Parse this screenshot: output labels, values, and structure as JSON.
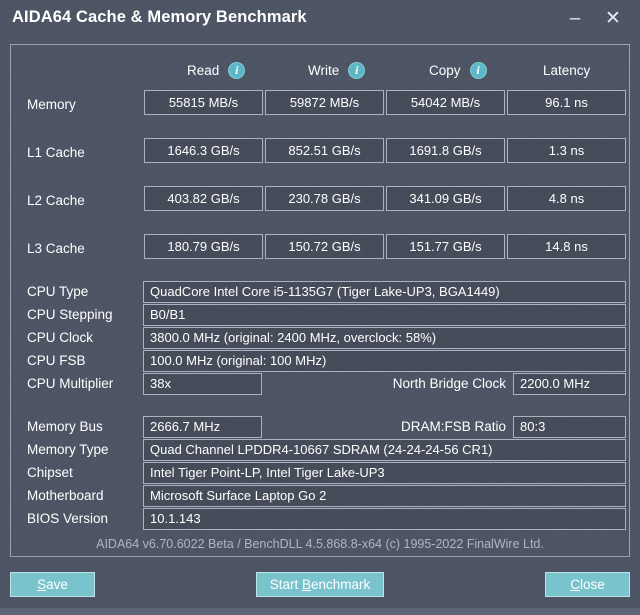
{
  "window": {
    "title": "AIDA64 Cache & Memory Benchmark",
    "minimize_glyph": "–",
    "close_glyph": "✕"
  },
  "benchmark": {
    "columns": [
      {
        "label": "Read",
        "info_icon": "info-icon",
        "has_info": true,
        "icon_glyph": "i"
      },
      {
        "label": "Write",
        "info_icon": "info-icon",
        "has_info": true,
        "icon_glyph": "i"
      },
      {
        "label": "Copy",
        "info_icon": "info-icon",
        "has_info": true,
        "icon_glyph": "i"
      },
      {
        "label": "Latency",
        "info_icon": "",
        "has_info": false,
        "icon_glyph": ""
      }
    ],
    "rows": [
      {
        "label": "Memory",
        "read": "55815 MB/s",
        "write": "59872 MB/s",
        "copy": "54042 MB/s",
        "latency": "96.1 ns"
      },
      {
        "label": "L1 Cache",
        "read": "1646.3 GB/s",
        "write": "852.51 GB/s",
        "copy": "1691.8 GB/s",
        "latency": "1.3 ns"
      },
      {
        "label": "L2 Cache",
        "read": "403.82 GB/s",
        "write": "230.78 GB/s",
        "copy": "341.09 GB/s",
        "latency": "4.8 ns"
      },
      {
        "label": "L3 Cache",
        "read": "180.79 GB/s",
        "write": "150.72 GB/s",
        "copy": "151.77 GB/s",
        "latency": "14.8 ns"
      }
    ]
  },
  "cpu_info": {
    "cpu_type_label": "CPU Type",
    "cpu_type_value": "QuadCore Intel Core i5-1135G7  (Tiger Lake-UP3, BGA1449)",
    "cpu_stepping_label": "CPU Stepping",
    "cpu_stepping_value": "B0/B1",
    "cpu_clock_label": "CPU Clock",
    "cpu_clock_value": "3800.0 MHz  (original: 2400 MHz, overclock: 58%)",
    "cpu_fsb_label": "CPU FSB",
    "cpu_fsb_value": "100.0 MHz  (original: 100 MHz)",
    "cpu_multiplier_label": "CPU Multiplier",
    "cpu_multiplier_value": "38x",
    "north_bridge_clock_label": "North Bridge Clock",
    "north_bridge_clock_value": "2200.0 MHz"
  },
  "memory_info": {
    "memory_bus_label": "Memory Bus",
    "memory_bus_value": "2666.7 MHz",
    "dram_fsb_ratio_label": "DRAM:FSB Ratio",
    "dram_fsb_ratio_value": "80:3",
    "memory_type_label": "Memory Type",
    "memory_type_value": "Quad Channel LPDDR4-10667 SDRAM  (24-24-24-56 CR1)",
    "chipset_label": "Chipset",
    "chipset_value": "Intel Tiger Point-LP, Intel Tiger Lake-UP3",
    "motherboard_label": "Motherboard",
    "motherboard_value": "Microsoft Surface Laptop Go 2",
    "bios_version_label": "BIOS Version",
    "bios_version_value": "10.1.143"
  },
  "footer": {
    "version_text": "AIDA64 v6.70.6022 Beta / BenchDLL 4.5.868.8-x64  (c) 1995-2022 FinalWire Ltd.",
    "save_prefix": "",
    "save_accel": "S",
    "save_suffix": "ave",
    "start_prefix": "Start ",
    "start_accel": "B",
    "start_suffix": "enchmark",
    "close_prefix": "",
    "close_accel": "C",
    "close_suffix": "lose"
  },
  "colors": {
    "window_bg": "#4d5464",
    "accent_teal": "#79c3cd",
    "info_icon": "#5bb8c4",
    "border": "#9aa3b2",
    "text": "#ffffff",
    "muted_text": "#aeb6c2"
  }
}
